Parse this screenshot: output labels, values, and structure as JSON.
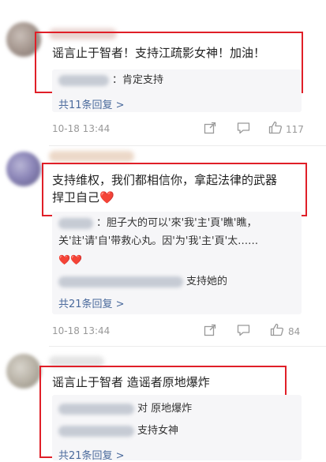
{
  "comments": [
    {
      "text": "谣言止于智者！支持江疏影女神！加油！",
      "replies": [
        {
          "text": "：肯定支持"
        }
      ],
      "more": "共11条回复 >",
      "date": "10-18 13:44",
      "likes": "117"
    },
    {
      "text_line1": "支持维权，我们都相信你，拿起法律的武器",
      "text_line2": "捍卫自己",
      "heart": "❤️",
      "reply_para_line1": "：胆子大的可以'來'我'主'頁'瞧'瞧，",
      "reply_para_line2": "关'註'请'自'带救心丸。因'为'我'主'頁'太……",
      "reply_hearts": "❤️❤️",
      "replies": [
        {
          "text": "支持她的"
        }
      ],
      "more": "共21条回复 >",
      "date": "10-18 13:44",
      "likes": "84"
    },
    {
      "text": "谣言止于智者 造谣者原地爆炸",
      "replies": [
        {
          "text": "对 原地爆炸"
        },
        {
          "text": "支持女神"
        }
      ],
      "more": "共21条回复 >"
    }
  ],
  "icons": {
    "share": "share-icon",
    "comment": "comment-icon",
    "like": "thumbs-up-icon"
  },
  "colors": {
    "highlight_box": "#e01f28",
    "link": "#4a6a9c",
    "meta": "#999999"
  }
}
